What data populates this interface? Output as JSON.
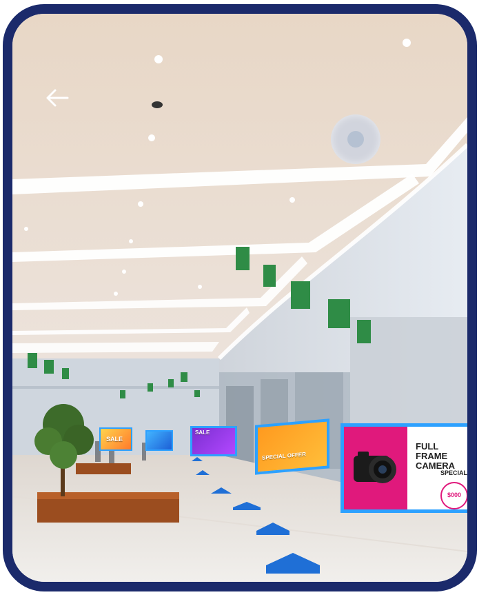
{
  "header": {
    "back_icon": "arrow-left-icon"
  },
  "controls": {
    "joystick_icon": "virtual-joystick"
  },
  "ads": [
    {
      "label": "SALE",
      "color": "#ff7a2b"
    },
    {
      "label": "",
      "color": "#1d5fd6"
    },
    {
      "label": "SALE",
      "color": "#7b2fd1"
    },
    {
      "label": "SPECIAL OFFER",
      "color": "#ff9a1f"
    },
    {
      "title": "FULL FRAME CAMERA",
      "special": "SPECIAL",
      "price": "$000",
      "color": "#e0197c"
    }
  ],
  "navigation": {
    "arrow_color": "#1f6fd6",
    "arrow_icon": "triangle-up-icon",
    "arrow_count": 6
  },
  "colors": {
    "frame": "#1b2a6b",
    "ad_border": "#2da1ff"
  }
}
